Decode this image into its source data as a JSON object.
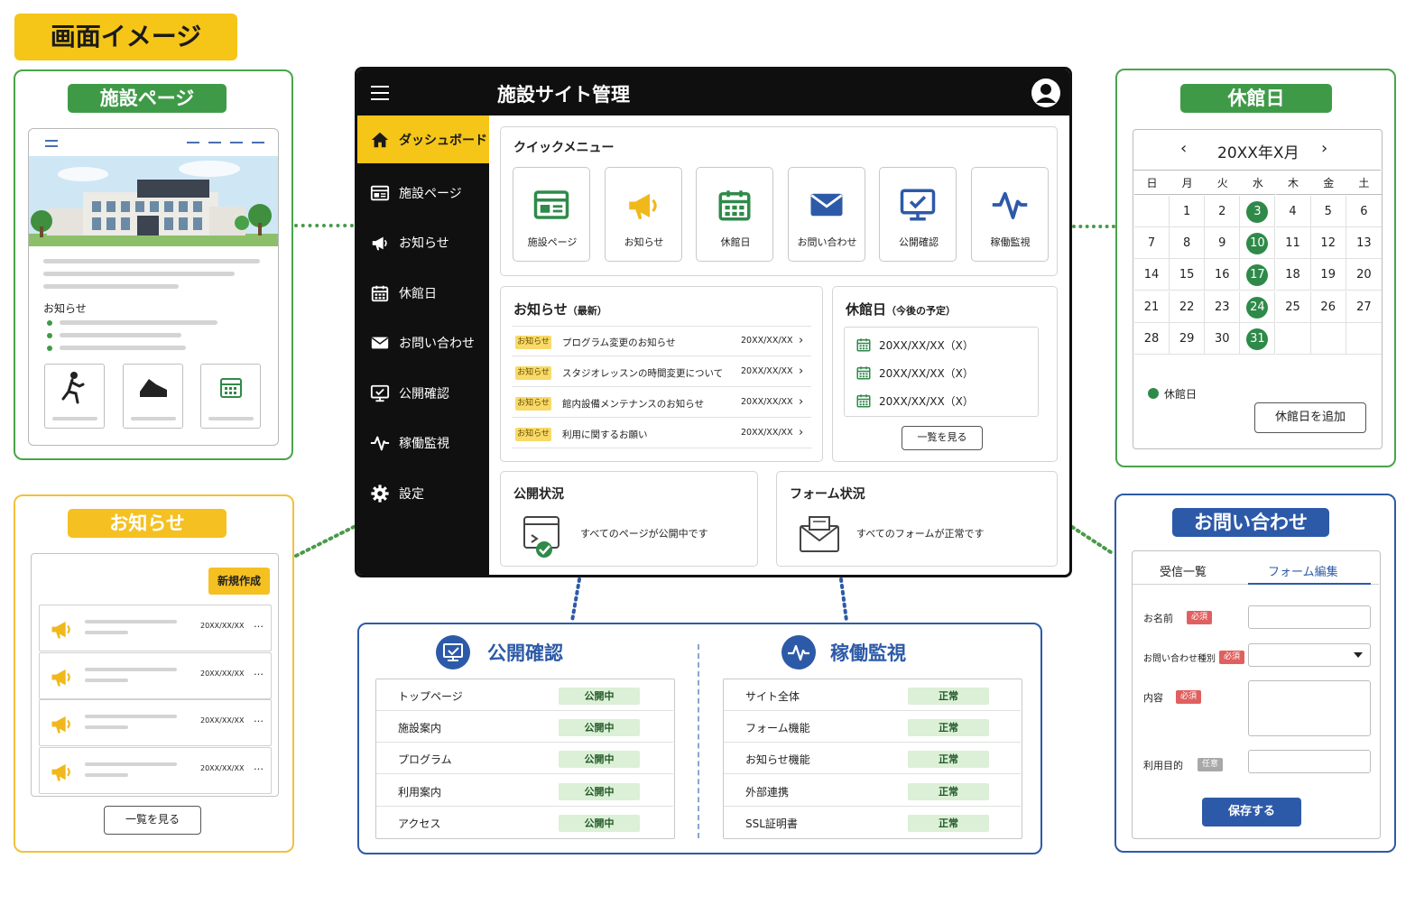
{
  "page_title": "画面イメージ",
  "colors": {
    "green": "#3f9a48",
    "yellow": "#f5c518",
    "blue": "#2d5aa8",
    "dark": "#0f0f0f"
  },
  "facility_panel": {
    "title": "施設ページ",
    "notices_label": "お知らせ"
  },
  "notices_panel": {
    "title": "お知らせ",
    "new_button": "新規作成",
    "rows": [
      {
        "date": "20XX/XX/XX",
        "more": "…"
      },
      {
        "date": "20XX/XX/XX",
        "more": "…"
      },
      {
        "date": "20XX/XX/XX",
        "more": "…"
      },
      {
        "date": "20XX/XX/XX",
        "more": "…"
      }
    ],
    "view_all": "一覧を見る"
  },
  "calendar_panel": {
    "title": "休館日",
    "month": "20XX年X月",
    "prev": "‹",
    "next": "›",
    "weekdays": [
      "日",
      "月",
      "火",
      "水",
      "木",
      "金",
      "土"
    ],
    "weeks": [
      [
        "",
        "1",
        "2",
        "3",
        "4",
        "5",
        "6"
      ],
      [
        "7",
        "8",
        "9",
        "10",
        "11",
        "12",
        "13"
      ],
      [
        "14",
        "15",
        "16",
        "17",
        "18",
        "19",
        "20"
      ],
      [
        "21",
        "22",
        "23",
        "24",
        "25",
        "26",
        "27"
      ],
      [
        "28",
        "29",
        "30",
        "31",
        "",
        "",
        ""
      ]
    ],
    "closed_days": [
      "3",
      "10",
      "17",
      "24",
      "31"
    ],
    "legend": "休館日",
    "add_button": "休館日を追加"
  },
  "inquiry_panel": {
    "title": "お問い合わせ",
    "tab_received": "受信一覧",
    "tab_form_edit": "フォーム編集",
    "field_name": "お名前",
    "field_type": "お問い合わせ種別",
    "field_content": "内容",
    "field_purpose": "利用目的",
    "required": "必須",
    "optional": "任意",
    "save_button": "保存する"
  },
  "main": {
    "header_title": "施設サイト管理",
    "sidebar": [
      {
        "label": "ダッシュボード",
        "icon": "home-icon",
        "active": true
      },
      {
        "label": "施設ページ",
        "icon": "page-icon",
        "active": false
      },
      {
        "label": "お知らせ",
        "icon": "megaphone-icon",
        "active": false
      },
      {
        "label": "休館日",
        "icon": "calendar-icon",
        "active": false
      },
      {
        "label": "お問い合わせ",
        "icon": "mail-icon",
        "active": false
      },
      {
        "label": "公開確認",
        "icon": "monitor-check-icon",
        "active": false
      },
      {
        "label": "稼働監視",
        "icon": "pulse-icon",
        "active": false
      },
      {
        "label": "設定",
        "icon": "gear-icon",
        "active": false
      }
    ],
    "quick_menu_title": "クイックメニュー",
    "quick_menu": [
      {
        "label": "施設ページ",
        "icon": "page-icon",
        "color": "#2f8a4a"
      },
      {
        "label": "お知らせ",
        "icon": "megaphone-icon",
        "color": "#f1b81c"
      },
      {
        "label": "休館日",
        "icon": "calendar-icon",
        "color": "#2f8a4a"
      },
      {
        "label": "お問い合わせ",
        "icon": "mail-icon",
        "color": "#2d5aa8"
      },
      {
        "label": "公開確認",
        "icon": "monitor-check-icon",
        "color": "#2d5aa8"
      },
      {
        "label": "稼働監視",
        "icon": "pulse-icon",
        "color": "#2d5aa8"
      }
    ],
    "news_title": "お知らせ",
    "news_subtitle": "（最新）",
    "news": [
      {
        "tag": "お知らせ",
        "title": "プログラム変更のお知らせ",
        "date": "20XX/XX/XX"
      },
      {
        "tag": "お知らせ",
        "title": "スタジオレッスンの時間変更について",
        "date": "20XX/XX/XX"
      },
      {
        "tag": "お知らせ",
        "title": "館内設備メンテナンスのお知らせ",
        "date": "20XX/XX/XX"
      },
      {
        "tag": "お知らせ",
        "title": "利用に関するお願い",
        "date": "20XX/XX/XX"
      }
    ],
    "holiday_title": "休館日",
    "holiday_subtitle": "（今後の予定）",
    "holidays": [
      "20XX/XX/XX（X）",
      "20XX/XX/XX（X）",
      "20XX/XX/XX（X）"
    ],
    "holiday_view_all": "一覧を見る",
    "publish_status_title": "公開状況",
    "publish_status_text": "すべてのページが公開中です",
    "form_status_title": "フォーム状況",
    "form_status_text": "すべてのフォームが正常です"
  },
  "publish_check": {
    "title": "公開確認",
    "rows": [
      {
        "name": "トップページ",
        "status": "公開中"
      },
      {
        "name": "施設案内",
        "status": "公開中"
      },
      {
        "name": "プログラム",
        "status": "公開中"
      },
      {
        "name": "利用案内",
        "status": "公開中"
      },
      {
        "name": "アクセス",
        "status": "公開中"
      }
    ]
  },
  "monitoring": {
    "title": "稼働監視",
    "rows": [
      {
        "name": "サイト全体",
        "status": "正常"
      },
      {
        "name": "フォーム機能",
        "status": "正常"
      },
      {
        "name": "お知らせ機能",
        "status": "正常"
      },
      {
        "name": "外部連携",
        "status": "正常"
      },
      {
        "name": "SSL証明書",
        "status": "正常"
      }
    ]
  }
}
